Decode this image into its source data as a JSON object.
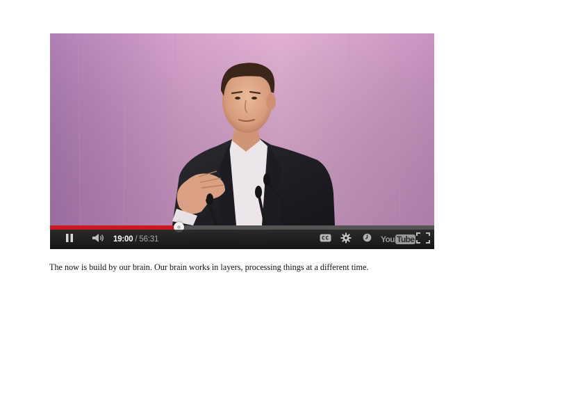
{
  "video": {
    "time_current": "19:00",
    "time_separator": "/",
    "time_duration": "56:31",
    "progress_fraction": 0.336,
    "state": "playing",
    "icons": {
      "pause": "pause-icon",
      "volume": "volume-icon",
      "captions": "closed-captions-icon",
      "settings": "gear-icon",
      "watch_later": "clock-icon",
      "fullscreen": "fullscreen-icon"
    },
    "logo": {
      "you": "You",
      "tube": "Tube"
    }
  },
  "caption": {
    "text": "The now is build by our brain. Our brain works in layers, processing things at a different time."
  },
  "colors": {
    "progress_played": "#cc181e",
    "control_bar": "#1e1e1e",
    "page_background": "#ffffff"
  }
}
